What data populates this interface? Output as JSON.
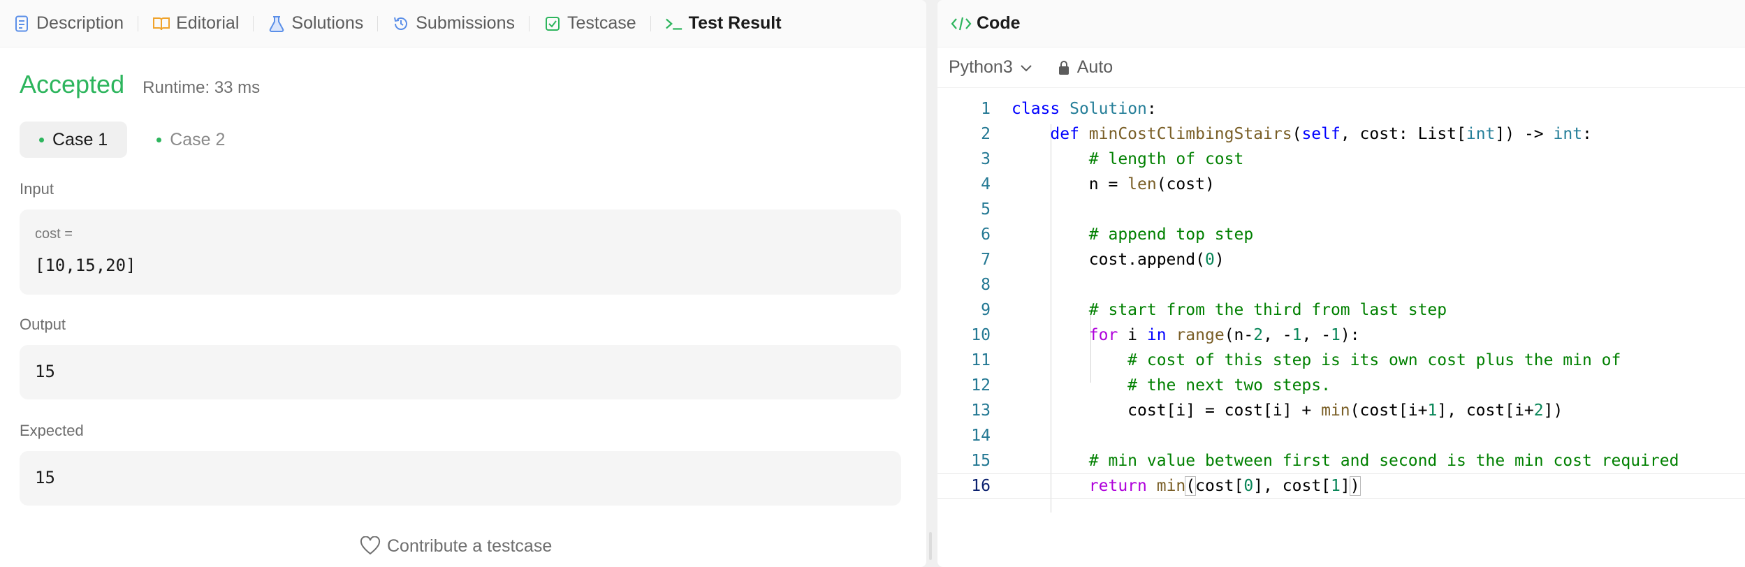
{
  "tabs": [
    {
      "label": "Description"
    },
    {
      "label": "Editorial"
    },
    {
      "label": "Solutions"
    },
    {
      "label": "Submissions"
    },
    {
      "label": "Testcase"
    },
    {
      "label": "Test Result"
    }
  ],
  "result": {
    "status": "Accepted",
    "runtime": "Runtime: 33 ms",
    "cases": [
      "Case 1",
      "Case 2"
    ],
    "input_label": "Input",
    "input_var": "cost =",
    "input_value": "[10,15,20]",
    "output_label": "Output",
    "output_value": "15",
    "expected_label": "Expected",
    "expected_value": "15",
    "contribute": "Contribute a testcase"
  },
  "code_panel": {
    "tab_label": "Code",
    "language": "Python3",
    "mode": "Auto"
  },
  "code_lines": [
    "class Solution:",
    "    def minCostClimbingStairs(self, cost: List[int]) -> int:",
    "        # length of cost",
    "        n = len(cost)",
    "",
    "        # append top step",
    "        cost.append(0)",
    "",
    "        # start from the third from last step",
    "        for i in range(n-2, -1, -1):",
    "            # cost of this step is its own cost plus the min of",
    "            # the next two steps.",
    "            cost[i] = cost[i] + min(cost[i+1], cost[i+2])",
    "",
    "        # min value between first and second is the min cost required",
    "        return min(cost[0], cost[1])"
  ],
  "line_numbers": [
    "1",
    "2",
    "3",
    "4",
    "5",
    "6",
    "7",
    "8",
    "9",
    "10",
    "11",
    "12",
    "13",
    "14",
    "15",
    "16"
  ],
  "colors": {
    "accepted": "#2db55d",
    "keyword": "#0000ff",
    "control": "#af00db",
    "class": "#267f99",
    "function": "#795e26",
    "comment": "#008000",
    "number": "#098658"
  },
  "icons": {
    "description": "document-icon",
    "editorial": "book-icon",
    "solutions": "flask-icon",
    "submissions": "history-icon",
    "testcase": "checkbox-icon",
    "test_result": "terminal-icon",
    "code": "code-brackets-icon",
    "lock": "lock-icon",
    "heart": "heart-icon"
  }
}
